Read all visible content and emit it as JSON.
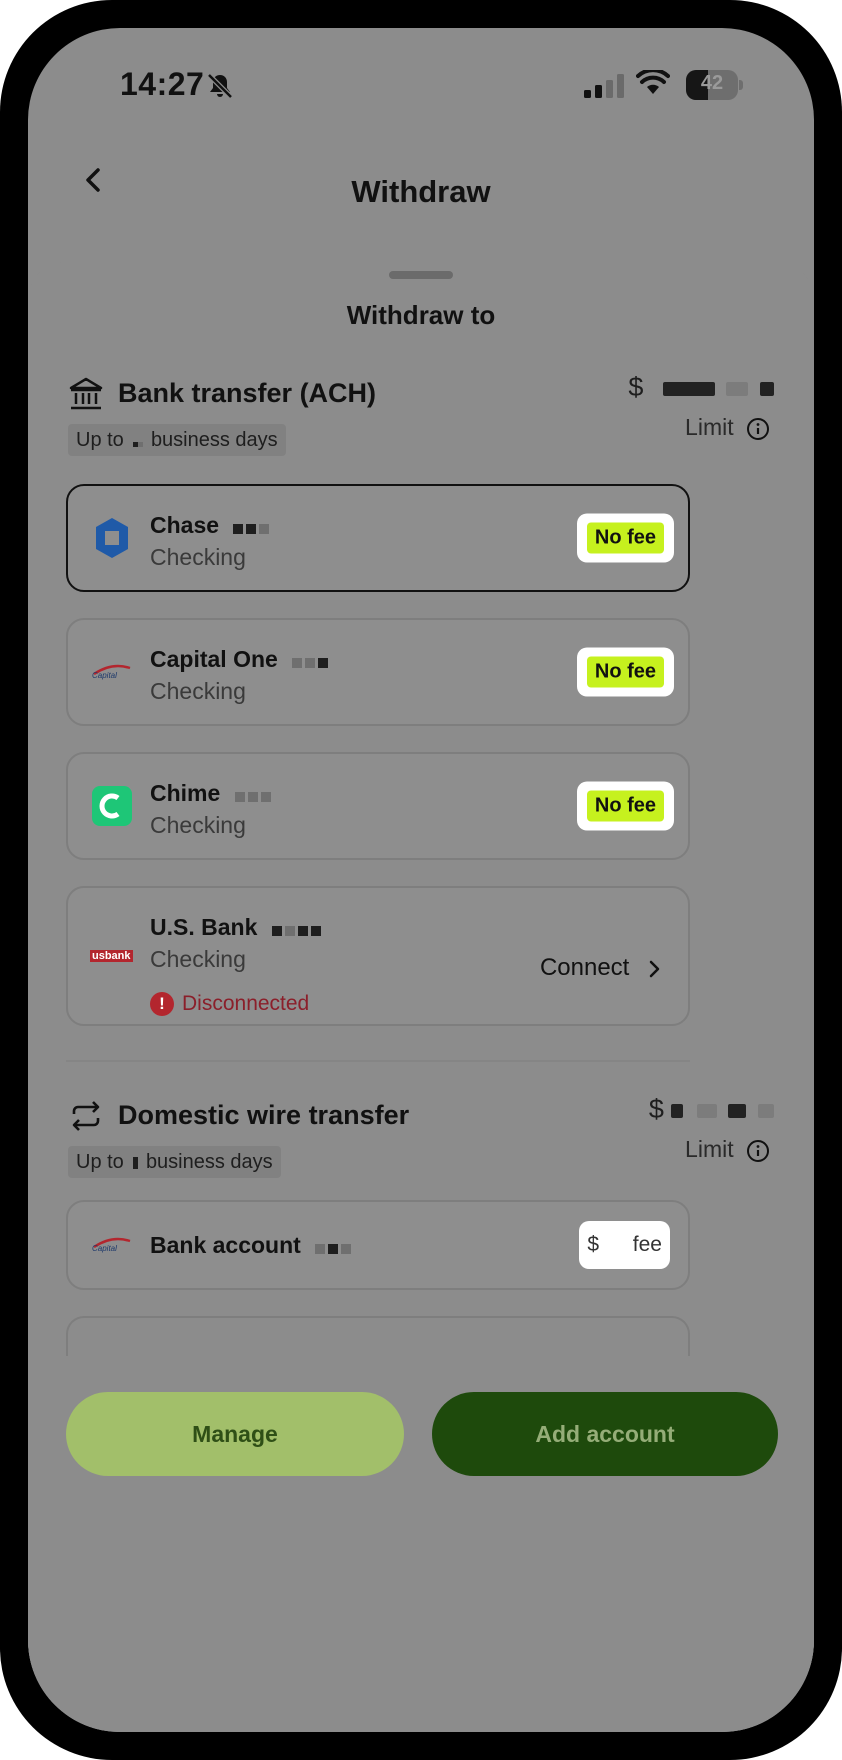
{
  "status_bar": {
    "time": "14:27",
    "battery_percent": "42",
    "battery_level": 0.42
  },
  "nav": {
    "title": "Withdraw"
  },
  "sheet": {
    "title": "Withdraw to"
  },
  "ach_section": {
    "name": "Bank transfer (ACH)",
    "chip_prefix": "Up to",
    "chip_suffix": "business days",
    "amount_prefix": "$",
    "limit_label": "Limit",
    "accounts": [
      {
        "name": "Chase",
        "type": "Checking",
        "fee": "No fee",
        "selected": true
      },
      {
        "name": "Capital One",
        "type": "Checking",
        "fee": "No fee",
        "selected": false
      },
      {
        "name": "Chime",
        "type": "Checking",
        "fee": "No fee",
        "selected": false
      },
      {
        "name": "U.S. Bank",
        "type": "Checking",
        "action": "Connect",
        "status": "Disconnected",
        "logo_text": "usbank"
      }
    ]
  },
  "wire_section": {
    "name": "Domestic wire transfer",
    "chip_prefix": "Up to",
    "chip_suffix": "business days",
    "amount_prefix": "$",
    "limit_label": "Limit",
    "accounts": [
      {
        "name": "Bank account",
        "fee_prefix": "$",
        "fee_suffix": "fee"
      }
    ]
  },
  "buttons": {
    "manage": "Manage",
    "add_account": "Add account"
  },
  "colors": {
    "fee_badge": "#c6f11e",
    "primary_dark": "#1e4a0c",
    "secondary_light": "#a2bf6a",
    "error": "#b3262e",
    "chase_blue": "#1f5aa8",
    "chime_green": "#1ec677"
  },
  "icons": {
    "back": "chevron-left-icon",
    "bell": "bell-slash-icon",
    "bank": "bank-icon",
    "wire": "repeat-arrows-icon",
    "info": "info-circle-icon",
    "connect": "chevron-right-icon",
    "alert": "alert-circle-icon"
  }
}
